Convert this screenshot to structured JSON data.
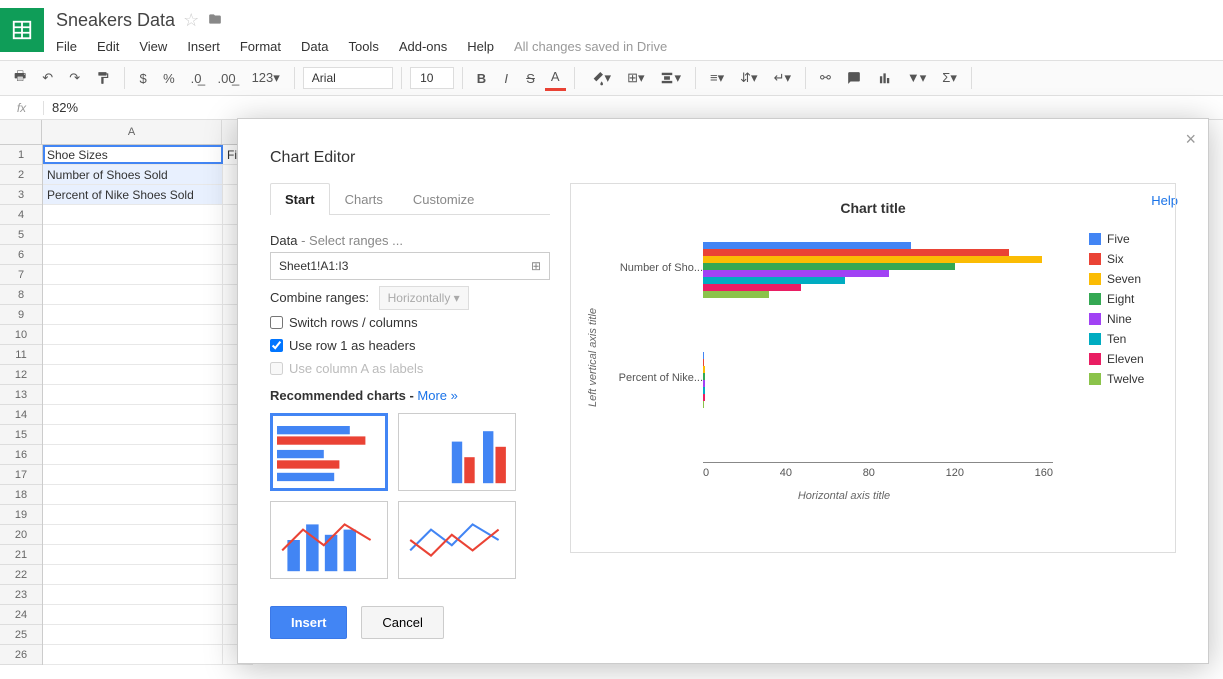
{
  "doc": {
    "title": "Sneakers Data"
  },
  "menus": [
    "File",
    "Edit",
    "View",
    "Insert",
    "Format",
    "Data",
    "Tools",
    "Add-ons",
    "Help"
  ],
  "save_status": "All changes saved in Drive",
  "toolbar": {
    "font": "Arial",
    "size": "10"
  },
  "fx": {
    "value": "82%"
  },
  "cols": [
    "A"
  ],
  "rows": [
    1,
    2,
    3,
    4,
    5,
    6,
    7,
    8,
    9,
    10,
    11,
    12,
    13,
    14,
    15,
    16,
    17,
    18,
    19,
    20,
    21,
    22,
    23,
    24,
    25,
    26
  ],
  "cells": {
    "A1": "Shoe Sizes",
    "A2": "Number of Shoes Sold",
    "A3": "Percent of Nike Shoes Sold",
    "B1": "Fi"
  },
  "dialog": {
    "title": "Chart Editor",
    "tabs": [
      "Start",
      "Charts",
      "Customize"
    ],
    "help": "Help",
    "data_label": "Data",
    "data_hint": " - Select ranges ...",
    "range": "Sheet1!A1:I3",
    "combine_label": "Combine ranges:",
    "combine_value": "Horizontally ▾",
    "switch_label": "Switch rows / columns",
    "headers_label": "Use row 1 as headers",
    "labels_label": "Use column A as labels",
    "rec_label": "Recommended charts",
    "rec_more": "More »",
    "insert": "Insert",
    "cancel": "Cancel"
  },
  "chart_data": {
    "type": "bar",
    "title": "Chart title",
    "ylabel": "Left vertical axis title",
    "xlabel": "Horizontal axis title",
    "xlim": [
      0,
      160
    ],
    "xticks": [
      0,
      40,
      80,
      120,
      160
    ],
    "categories": [
      "Number of Sho...",
      "Percent of Nike..."
    ],
    "series": [
      {
        "name": "Five",
        "color": "#4285f4",
        "values": [
          95,
          0.5
        ]
      },
      {
        "name": "Six",
        "color": "#ea4335",
        "values": [
          140,
          0.6
        ]
      },
      {
        "name": "Seven",
        "color": "#fbbc04",
        "values": [
          155,
          0.7
        ]
      },
      {
        "name": "Eight",
        "color": "#34a853",
        "values": [
          115,
          0.8
        ]
      },
      {
        "name": "Nine",
        "color": "#a142f4",
        "values": [
          85,
          0.9
        ]
      },
      {
        "name": "Ten",
        "color": "#00acc1",
        "values": [
          65,
          1.0
        ]
      },
      {
        "name": "Eleven",
        "color": "#e91e63",
        "values": [
          45,
          0.8
        ]
      },
      {
        "name": "Twelve",
        "color": "#8bc34a",
        "values": [
          30,
          0.6
        ]
      }
    ]
  }
}
